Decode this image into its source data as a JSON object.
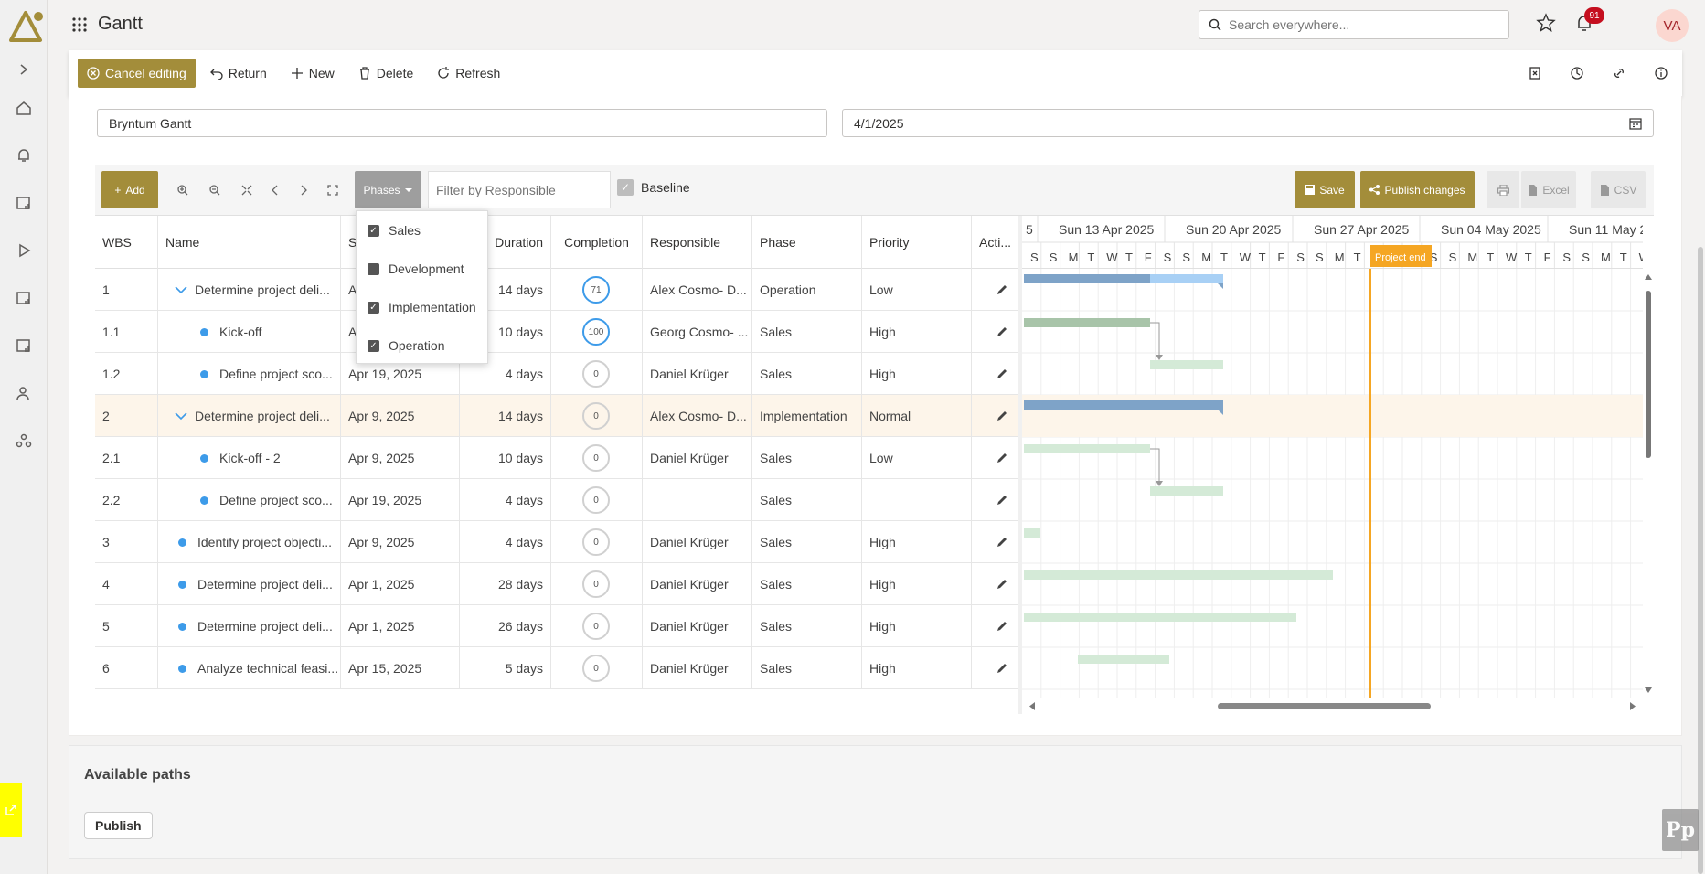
{
  "app": {
    "title": "Gantt",
    "notifications": "91",
    "avatar": "VA",
    "search_placeholder": "Search everywhere..."
  },
  "commands": {
    "cancel": "Cancel editing",
    "return": "Return",
    "new": "New",
    "delete": "Delete",
    "refresh": "Refresh"
  },
  "form": {
    "name": "Bryntum Gantt",
    "date": "4/1/2025"
  },
  "toolbar": {
    "add": "Add",
    "phases": "Phases",
    "filter_placeholder": "Filter by Responsible",
    "baseline": "Baseline",
    "save": "Save",
    "publish": "Publish changes",
    "excel": "Excel",
    "csv": "CSV"
  },
  "phases_menu": [
    {
      "label": "Sales",
      "checked": true
    },
    {
      "label": "Development",
      "checked": false
    },
    {
      "label": "Implementation",
      "checked": true
    },
    {
      "label": "Operation",
      "checked": true
    }
  ],
  "columns": [
    "WBS",
    "Name",
    "S",
    "Duration",
    "Completion",
    "Responsible",
    "Phase",
    "Priority",
    "Acti..."
  ],
  "rows": [
    {
      "wbs": "1",
      "name": "Determine project deli...",
      "start": "A",
      "duration": "14 days",
      "completion": "71",
      "responsible": "Alex Cosmo- D...",
      "phase": "Operation",
      "priority": "Low",
      "level": 0,
      "parent": true
    },
    {
      "wbs": "1.1",
      "name": "Kick-off",
      "start": "A",
      "duration": "10 days",
      "completion": "100",
      "responsible": "Georg Cosmo- ...",
      "phase": "Sales",
      "priority": "High",
      "level": 1
    },
    {
      "wbs": "1.2",
      "name": "Define project sco...",
      "start": "Apr 19, 2025",
      "duration": "4 days",
      "completion": "0",
      "responsible": "Daniel Krüger",
      "phase": "Sales",
      "priority": "High",
      "level": 1
    },
    {
      "wbs": "2",
      "name": "Determine project deli...",
      "start": "Apr 9, 2025",
      "duration": "14 days",
      "completion": "0",
      "responsible": "Alex Cosmo- D...",
      "phase": "Implementation",
      "priority": "Normal",
      "level": 0,
      "parent": true,
      "highlight": true
    },
    {
      "wbs": "2.1",
      "name": "Kick-off - 2",
      "start": "Apr 9, 2025",
      "duration": "10 days",
      "completion": "0",
      "responsible": "Daniel Krüger",
      "phase": "Sales",
      "priority": "Low",
      "level": 1
    },
    {
      "wbs": "2.2",
      "name": "Define project sco...",
      "start": "Apr 19, 2025",
      "duration": "4 days",
      "completion": "0",
      "responsible": "",
      "phase": "Sales",
      "priority": "",
      "level": 1
    },
    {
      "wbs": "3",
      "name": "Identify project objecti...",
      "start": "Apr 9, 2025",
      "duration": "4 days",
      "completion": "0",
      "responsible": "Daniel Krüger",
      "phase": "Sales",
      "priority": "High",
      "level": 0
    },
    {
      "wbs": "4",
      "name": "Determine project deli...",
      "start": "Apr 1, 2025",
      "duration": "28 days",
      "completion": "0",
      "responsible": "Daniel Krüger",
      "phase": "Sales",
      "priority": "High",
      "level": 0
    },
    {
      "wbs": "5",
      "name": "Determine project deli...",
      "start": "Apr 1, 2025",
      "duration": "26 days",
      "completion": "0",
      "responsible": "Daniel Krüger",
      "phase": "Sales",
      "priority": "High",
      "level": 0
    },
    {
      "wbs": "6",
      "name": "Analyze technical feasi...",
      "start": "Apr 15, 2025",
      "duration": "5 days",
      "completion": "0",
      "responsible": "Daniel Krüger",
      "phase": "Sales",
      "priority": "High",
      "level": 0
    }
  ],
  "timeline": {
    "weeks": [
      "5",
      "Sun 13 Apr 2025",
      "Sun 20 Apr 2025",
      "Sun 27 Apr 2025",
      "Sun 04 May 2025",
      "Sun 11 May 2"
    ],
    "days": [
      "S",
      "S",
      "M",
      "T",
      "W",
      "T",
      "F",
      "S",
      "S",
      "M",
      "T",
      "W",
      "T",
      "F",
      "S",
      "S",
      "M",
      "T",
      "W",
      "T",
      "F",
      "S",
      "S",
      "M",
      "T",
      "W",
      "T",
      "F",
      "S",
      "S",
      "M",
      "T",
      "W",
      "T"
    ],
    "project_end": "Project end",
    "colors": {
      "parent_bar": "#7ea3c8",
      "parent_progress": "#a8d0f5",
      "task_bar": "#d4ead7",
      "task_progress": "#a8c4a9",
      "project_end": "#f5a623"
    }
  },
  "paths": {
    "title": "Available paths",
    "publish": "Publish"
  }
}
